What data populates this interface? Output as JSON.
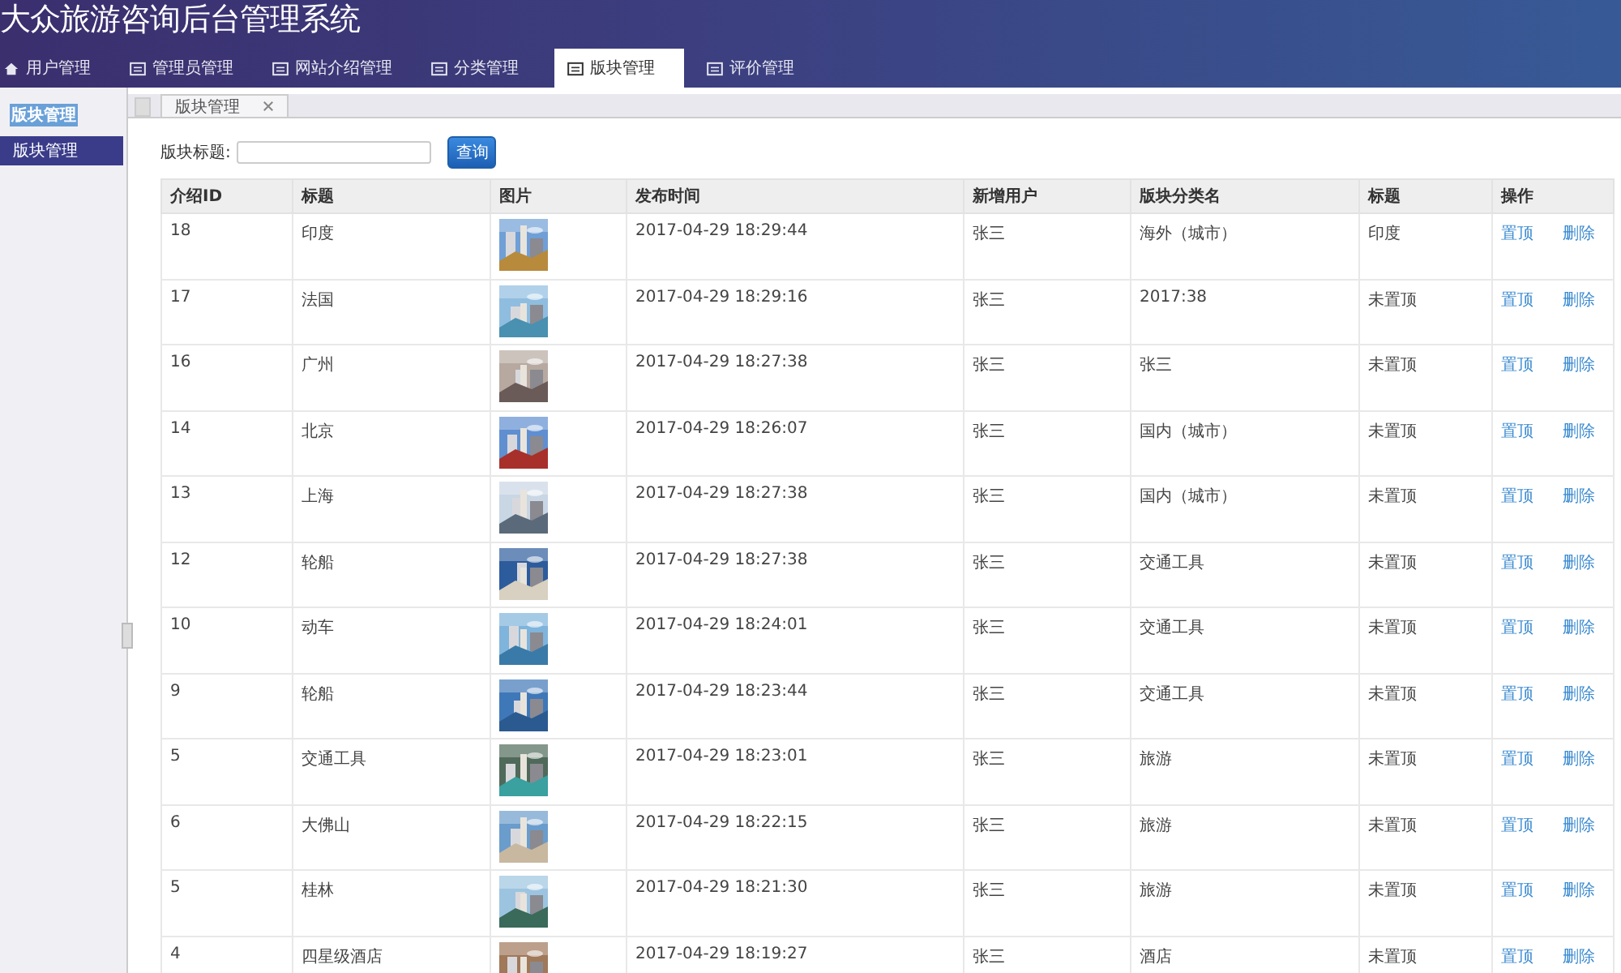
{
  "app_title": "大众旅游咨询后台管理系统",
  "nav_tabs": [
    {
      "label": "用户管理",
      "kind": "home",
      "selected": false
    },
    {
      "label": "管理员管理",
      "kind": "page",
      "selected": false
    },
    {
      "label": "网站介绍管理",
      "kind": "page",
      "selected": false
    },
    {
      "label": "分类管理",
      "kind": "page",
      "selected": false
    },
    {
      "label": "版块管理",
      "kind": "page",
      "selected": true
    },
    {
      "label": "评价管理",
      "kind": "page",
      "selected": false
    }
  ],
  "sidebar": {
    "title": "版块管理",
    "items": [
      {
        "label": "版块管理",
        "selected": true
      }
    ]
  },
  "page_tabs": [
    {
      "label": "版块管理"
    }
  ],
  "search": {
    "label": "版块标题:",
    "button": "查询"
  },
  "table": {
    "columns": [
      "介绍ID",
      "标题",
      "图片",
      "发布时间",
      "新增用户",
      "版块分类名",
      "标题",
      "操作"
    ],
    "rows": [
      {
        "id": "18",
        "title": "印度",
        "time": "2017-04-29 18:29:44",
        "user": "张三",
        "category": "海外（城市）",
        "status": "印度",
        "actions": [
          "置顶",
          "删除"
        ]
      },
      {
        "id": "17",
        "title": "法国",
        "time": "2017-04-29 18:29:16",
        "user": "张三",
        "category": "2017:38",
        "status": "未置顶",
        "actions": [
          "置顶",
          "删除"
        ]
      },
      {
        "id": "16",
        "title": "广州",
        "time": "2017-04-29 18:27:38",
        "user": "张三",
        "category": "张三",
        "status": "未置顶",
        "actions": [
          "置顶",
          "删除"
        ]
      },
      {
        "id": "14",
        "title": "北京",
        "time": "2017-04-29 18:26:07",
        "user": "张三",
        "category": "国内（城市）",
        "status": "未置顶",
        "actions": [
          "置顶",
          "删除"
        ]
      },
      {
        "id": "13",
        "title": "上海",
        "time": "2017-04-29 18:27:38",
        "user": "张三",
        "category": "国内（城市）",
        "status": "未置顶",
        "actions": [
          "置顶",
          "删除"
        ]
      },
      {
        "id": "12",
        "title": "轮船",
        "time": "2017-04-29 18:27:38",
        "user": "张三",
        "category": "交通工具",
        "status": "未置顶",
        "actions": [
          "置顶",
          "删除"
        ]
      },
      {
        "id": "10",
        "title": "动车",
        "time": "2017-04-29 18:24:01",
        "user": "张三",
        "category": "交通工具",
        "status": "未置顶",
        "actions": [
          "置顶",
          "删除"
        ]
      },
      {
        "id": "9",
        "title": "轮船",
        "time": "2017-04-29 18:23:44",
        "user": "张三",
        "category": "交通工具",
        "status": "未置顶",
        "actions": [
          "置顶",
          "删除"
        ]
      },
      {
        "id": "5",
        "title": "交通工具",
        "time": "2017-04-29 18:23:01",
        "user": "张三",
        "category": "旅游",
        "status": "未置顶",
        "actions": [
          "置顶",
          "删除"
        ]
      },
      {
        "id": "6",
        "title": "大佛山",
        "time": "2017-04-29 18:22:15",
        "user": "张三",
        "category": "旅游",
        "status": "未置顶",
        "actions": [
          "置顶",
          "删除"
        ]
      },
      {
        "id": "5",
        "title": "桂林",
        "time": "2017-04-29 18:21:30",
        "user": "张三",
        "category": "旅游",
        "status": "未置顶",
        "actions": [
          "置顶",
          "删除"
        ]
      },
      {
        "id": "4",
        "title": "四星级酒店",
        "time": "2017-04-29 18:19:27",
        "user": "张三",
        "category": "酒店",
        "status": "未置顶",
        "actions": [
          "置顶",
          "删除"
        ]
      }
    ]
  }
}
